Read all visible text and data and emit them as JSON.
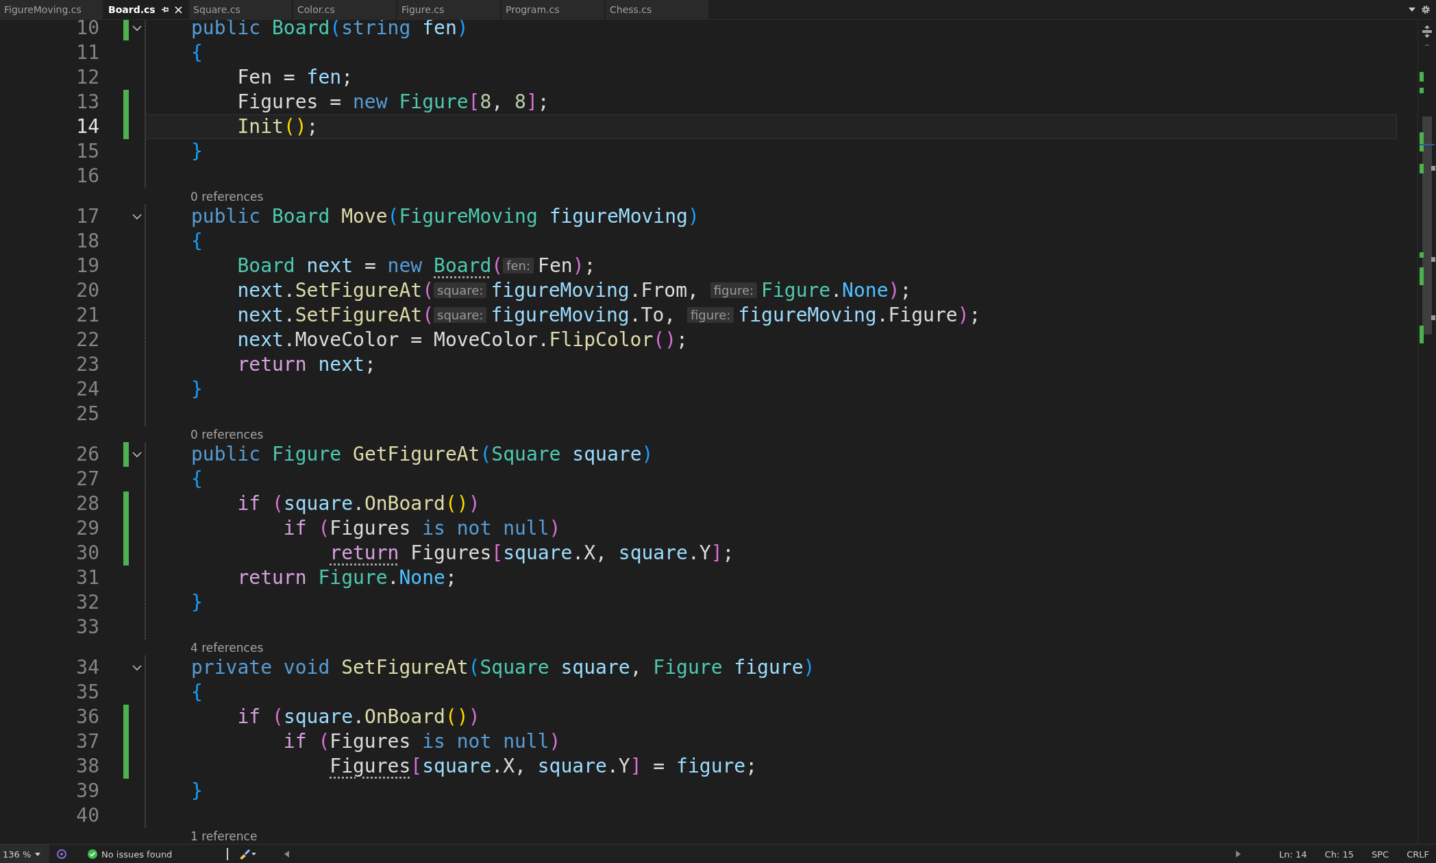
{
  "tabs": [
    {
      "label": "FigureMoving.cs",
      "selected": false
    },
    {
      "label": "Board.cs",
      "selected": true
    },
    {
      "label": "Square.cs",
      "selected": false
    },
    {
      "label": "Color.cs",
      "selected": false
    },
    {
      "label": "Figure.cs",
      "selected": false
    },
    {
      "label": "Program.cs",
      "selected": false
    },
    {
      "label": "Chess.cs",
      "selected": false
    }
  ],
  "editor": {
    "rows": [
      {
        "kind": "code",
        "number": "10",
        "changed": true,
        "foldable": true,
        "current": false,
        "tokens": [
          {
            "text": "public ",
            "kind": "kw"
          },
          {
            "text": "Board",
            "kind": "type"
          },
          {
            "text": "(",
            "kind": "b3"
          },
          {
            "text": "string ",
            "kind": "kw"
          },
          {
            "text": "fen",
            "kind": "param"
          },
          {
            "text": ")",
            "kind": "b3"
          }
        ]
      },
      {
        "kind": "code",
        "number": "11",
        "changed": false,
        "foldable": false,
        "current": false,
        "tokens": [
          {
            "text": "{",
            "kind": "b3"
          }
        ]
      },
      {
        "kind": "code",
        "number": "12",
        "changed": false,
        "foldable": false,
        "current": false,
        "tokens": [
          {
            "text": "    Fen = ",
            "kind": "p"
          },
          {
            "text": "fen",
            "kind": "param"
          },
          {
            "text": ";",
            "kind": "p"
          }
        ]
      },
      {
        "kind": "code",
        "number": "13",
        "changed": true,
        "foldable": false,
        "current": false,
        "tokens": [
          {
            "text": "    Figures = ",
            "kind": "p"
          },
          {
            "text": "new ",
            "kind": "kw"
          },
          {
            "text": "Figure",
            "kind": "type"
          },
          {
            "text": "[",
            "kind": "b2"
          },
          {
            "text": "8",
            "kind": "num"
          },
          {
            "text": ", ",
            "kind": "p"
          },
          {
            "text": "8",
            "kind": "num"
          },
          {
            "text": "]",
            "kind": "b2"
          },
          {
            "text": ";",
            "kind": "p"
          }
        ]
      },
      {
        "kind": "code",
        "number": "14",
        "changed": true,
        "foldable": false,
        "current": true,
        "tokens": [
          {
            "text": "    Init",
            "kind": "method"
          },
          {
            "text": "()",
            "kind": "b1"
          },
          {
            "text": ";",
            "kind": "p"
          }
        ]
      },
      {
        "kind": "code",
        "number": "15",
        "changed": false,
        "foldable": false,
        "current": false,
        "tokens": [
          {
            "text": "}",
            "kind": "b3"
          }
        ]
      },
      {
        "kind": "code",
        "number": "16",
        "changed": false,
        "foldable": false,
        "current": false,
        "tokens": []
      },
      {
        "kind": "lens",
        "text": "0 references"
      },
      {
        "kind": "code",
        "number": "17",
        "changed": false,
        "foldable": true,
        "current": false,
        "tokens": [
          {
            "text": "public ",
            "kind": "kw"
          },
          {
            "text": "Board ",
            "kind": "type"
          },
          {
            "text": "Move",
            "kind": "method"
          },
          {
            "text": "(",
            "kind": "b3"
          },
          {
            "text": "FigureMoving ",
            "kind": "type"
          },
          {
            "text": "figureMoving",
            "kind": "param"
          },
          {
            "text": ")",
            "kind": "b3"
          }
        ]
      },
      {
        "kind": "code",
        "number": "18",
        "changed": false,
        "foldable": false,
        "current": false,
        "tokens": [
          {
            "text": "{",
            "kind": "b3"
          }
        ]
      },
      {
        "kind": "code",
        "number": "19",
        "changed": false,
        "foldable": false,
        "current": false,
        "tokens": [
          {
            "text": "    Board ",
            "kind": "type"
          },
          {
            "text": "next",
            "kind": "param"
          },
          {
            "text": " = ",
            "kind": "p"
          },
          {
            "text": "new ",
            "kind": "kw"
          },
          {
            "text": "Board",
            "kind": "type",
            "dotted": true
          },
          {
            "text": "(",
            "kind": "b2"
          },
          {
            "text": "fen:",
            "kind": "hint"
          },
          {
            "text": "Fen",
            "kind": "p"
          },
          {
            "text": ")",
            "kind": "b2"
          },
          {
            "text": ";",
            "kind": "p"
          }
        ]
      },
      {
        "kind": "code",
        "number": "20",
        "changed": false,
        "foldable": false,
        "current": false,
        "tokens": [
          {
            "text": "    next",
            "kind": "param"
          },
          {
            "text": ".",
            "kind": "p"
          },
          {
            "text": "SetFigureAt",
            "kind": "method"
          },
          {
            "text": "(",
            "kind": "b2"
          },
          {
            "text": "square:",
            "kind": "hint"
          },
          {
            "text": "figureMoving",
            "kind": "param"
          },
          {
            "text": ".From, ",
            "kind": "p"
          },
          {
            "text": "figure:",
            "kind": "hint"
          },
          {
            "text": "Figure",
            "kind": "type"
          },
          {
            "text": ".",
            "kind": "p"
          },
          {
            "text": "None",
            "kind": "enum"
          },
          {
            "text": ")",
            "kind": "b2"
          },
          {
            "text": ";",
            "kind": "p"
          }
        ]
      },
      {
        "kind": "code",
        "number": "21",
        "changed": false,
        "foldable": false,
        "current": false,
        "tokens": [
          {
            "text": "    next",
            "kind": "param"
          },
          {
            "text": ".",
            "kind": "p"
          },
          {
            "text": "SetFigureAt",
            "kind": "method"
          },
          {
            "text": "(",
            "kind": "b2"
          },
          {
            "text": "square:",
            "kind": "hint"
          },
          {
            "text": "figureMoving",
            "kind": "param"
          },
          {
            "text": ".To, ",
            "kind": "p"
          },
          {
            "text": "figure:",
            "kind": "hint"
          },
          {
            "text": "figureMoving",
            "kind": "param"
          },
          {
            "text": ".Figure",
            "kind": "p"
          },
          {
            "text": ")",
            "kind": "b2"
          },
          {
            "text": ";",
            "kind": "p"
          }
        ]
      },
      {
        "kind": "code",
        "number": "22",
        "changed": false,
        "foldable": false,
        "current": false,
        "tokens": [
          {
            "text": "    next",
            "kind": "param"
          },
          {
            "text": ".MoveColor = MoveColor.",
            "kind": "p"
          },
          {
            "text": "FlipColor",
            "kind": "method"
          },
          {
            "text": "()",
            "kind": "b2"
          },
          {
            "text": ";",
            "kind": "p"
          }
        ]
      },
      {
        "kind": "code",
        "number": "23",
        "changed": false,
        "foldable": false,
        "current": false,
        "tokens": [
          {
            "text": "    return ",
            "kind": "ctl"
          },
          {
            "text": "next",
            "kind": "param"
          },
          {
            "text": ";",
            "kind": "p"
          }
        ]
      },
      {
        "kind": "code",
        "number": "24",
        "changed": false,
        "foldable": false,
        "current": false,
        "tokens": [
          {
            "text": "}",
            "kind": "b3"
          }
        ]
      },
      {
        "kind": "code",
        "number": "25",
        "changed": false,
        "foldable": false,
        "current": false,
        "tokens": []
      },
      {
        "kind": "lens",
        "text": "0 references"
      },
      {
        "kind": "code",
        "number": "26",
        "changed": true,
        "foldable": true,
        "current": false,
        "tokens": [
          {
            "text": "public ",
            "kind": "kw"
          },
          {
            "text": "Figure ",
            "kind": "type"
          },
          {
            "text": "GetFigureAt",
            "kind": "method"
          },
          {
            "text": "(",
            "kind": "b3"
          },
          {
            "text": "Square ",
            "kind": "type"
          },
          {
            "text": "square",
            "kind": "param"
          },
          {
            "text": ")",
            "kind": "b3"
          }
        ]
      },
      {
        "kind": "code",
        "number": "27",
        "changed": false,
        "foldable": false,
        "current": false,
        "tokens": [
          {
            "text": "{",
            "kind": "b3"
          }
        ]
      },
      {
        "kind": "code",
        "number": "28",
        "changed": true,
        "foldable": false,
        "current": false,
        "tokens": [
          {
            "text": "    if ",
            "kind": "ctl"
          },
          {
            "text": "(",
            "kind": "b2"
          },
          {
            "text": "square",
            "kind": "param"
          },
          {
            "text": ".",
            "kind": "p"
          },
          {
            "text": "OnBoard",
            "kind": "method"
          },
          {
            "text": "()",
            "kind": "b1"
          },
          {
            "text": ")",
            "kind": "b2"
          }
        ]
      },
      {
        "kind": "code",
        "number": "29",
        "changed": true,
        "foldable": false,
        "current": false,
        "tokens": [
          {
            "text": "        if ",
            "kind": "ctl"
          },
          {
            "text": "(",
            "kind": "b2"
          },
          {
            "text": "Figures ",
            "kind": "p"
          },
          {
            "text": "is not null",
            "kind": "kw"
          },
          {
            "text": ")",
            "kind": "b2"
          }
        ]
      },
      {
        "kind": "code",
        "number": "30",
        "changed": true,
        "foldable": false,
        "current": false,
        "tokens": [
          {
            "text": "            return",
            "kind": "ctl",
            "dotted": true
          },
          {
            "text": " Figures",
            "kind": "p"
          },
          {
            "text": "[",
            "kind": "b2"
          },
          {
            "text": "square",
            "kind": "param"
          },
          {
            "text": ".X, ",
            "kind": "p"
          },
          {
            "text": "square",
            "kind": "param"
          },
          {
            "text": ".Y",
            "kind": "p"
          },
          {
            "text": "]",
            "kind": "b2"
          },
          {
            "text": ";",
            "kind": "p"
          }
        ]
      },
      {
        "kind": "code",
        "number": "31",
        "changed": false,
        "foldable": false,
        "current": false,
        "tokens": [
          {
            "text": "    return ",
            "kind": "ctl"
          },
          {
            "text": "Figure",
            "kind": "type"
          },
          {
            "text": ".",
            "kind": "p"
          },
          {
            "text": "None",
            "kind": "enum"
          },
          {
            "text": ";",
            "kind": "p"
          }
        ]
      },
      {
        "kind": "code",
        "number": "32",
        "changed": false,
        "foldable": false,
        "current": false,
        "tokens": [
          {
            "text": "}",
            "kind": "b3"
          }
        ]
      },
      {
        "kind": "code",
        "number": "33",
        "changed": false,
        "foldable": false,
        "current": false,
        "tokens": []
      },
      {
        "kind": "lens",
        "text": "4 references"
      },
      {
        "kind": "code",
        "number": "34",
        "changed": false,
        "foldable": true,
        "current": false,
        "tokens": [
          {
            "text": "private void ",
            "kind": "kw"
          },
          {
            "text": "SetFigureAt",
            "kind": "method"
          },
          {
            "text": "(",
            "kind": "b3"
          },
          {
            "text": "Square ",
            "kind": "type"
          },
          {
            "text": "square",
            "kind": "param"
          },
          {
            "text": ", ",
            "kind": "p"
          },
          {
            "text": "Figure ",
            "kind": "type"
          },
          {
            "text": "figure",
            "kind": "param"
          },
          {
            "text": ")",
            "kind": "b3"
          }
        ]
      },
      {
        "kind": "code",
        "number": "35",
        "changed": false,
        "foldable": false,
        "current": false,
        "tokens": [
          {
            "text": "{",
            "kind": "b3"
          }
        ]
      },
      {
        "kind": "code",
        "number": "36",
        "changed": true,
        "foldable": false,
        "current": false,
        "tokens": [
          {
            "text": "    if ",
            "kind": "ctl"
          },
          {
            "text": "(",
            "kind": "b2"
          },
          {
            "text": "square",
            "kind": "param"
          },
          {
            "text": ".",
            "kind": "p"
          },
          {
            "text": "OnBoard",
            "kind": "method"
          },
          {
            "text": "()",
            "kind": "b1"
          },
          {
            "text": ")",
            "kind": "b2"
          }
        ]
      },
      {
        "kind": "code",
        "number": "37",
        "changed": true,
        "foldable": false,
        "current": false,
        "tokens": [
          {
            "text": "        if ",
            "kind": "ctl"
          },
          {
            "text": "(",
            "kind": "b2"
          },
          {
            "text": "Figures ",
            "kind": "p"
          },
          {
            "text": "is not null",
            "kind": "kw"
          },
          {
            "text": ")",
            "kind": "b2"
          }
        ]
      },
      {
        "kind": "code",
        "number": "38",
        "changed": true,
        "foldable": false,
        "current": false,
        "tokens": [
          {
            "text": "            Figures",
            "kind": "p",
            "dotted": true
          },
          {
            "text": "[",
            "kind": "b2"
          },
          {
            "text": "square",
            "kind": "param"
          },
          {
            "text": ".X, ",
            "kind": "p"
          },
          {
            "text": "square",
            "kind": "param"
          },
          {
            "text": ".Y",
            "kind": "p"
          },
          {
            "text": "]",
            "kind": "b2"
          },
          {
            "text": " = ",
            "kind": "p"
          },
          {
            "text": "figure",
            "kind": "param"
          },
          {
            "text": ";",
            "kind": "p"
          }
        ]
      },
      {
        "kind": "code",
        "number": "39",
        "changed": false,
        "foldable": false,
        "current": false,
        "tokens": [
          {
            "text": "}",
            "kind": "b3"
          }
        ]
      },
      {
        "kind": "code",
        "number": "40",
        "changed": false,
        "foldable": false,
        "current": false,
        "tokens": []
      },
      {
        "kind": "lens",
        "text": "1 reference"
      }
    ]
  },
  "status_bar": {
    "zoom": "136 %",
    "issues": "No issues found",
    "line": "Ln: 14",
    "column": "Ch: 15",
    "indent": "SPC",
    "line_ending": "CRLF"
  }
}
